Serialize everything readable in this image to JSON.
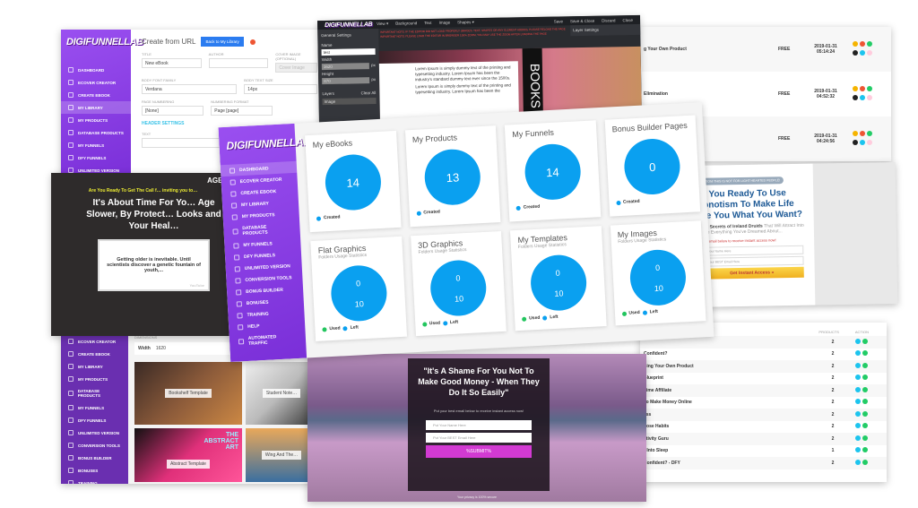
{
  "brand": {
    "logo": "DIGIFUNNELLAB",
    "primary": "#8a3fe6",
    "accent": "#0aa0f0",
    "used": "#22c55e"
  },
  "sidebar": {
    "items": [
      "DASHBOARD",
      "ECOVER CREATOR",
      "CREATE EBOOK",
      "MY LIBRARY",
      "MY PRODUCTS",
      "DATABASE PRODUCTS",
      "MY FUNNELS",
      "DFY FUNNELS",
      "UNLIMITED VERSION",
      "CONVERSION TOOLS",
      "BONUS BUILDER",
      "BONUSES",
      "TRAINING",
      "HELP",
      "AUTOMATED TRAFFIC"
    ]
  },
  "create_from_url": {
    "title": "Create from URL",
    "back_button": "Back to My Library",
    "fields": [
      {
        "label": "TITLE",
        "value": "New eBook"
      },
      {
        "label": "AUTHOR",
        "value": ""
      },
      {
        "label": "COVER IMAGE (OPTIONAL)",
        "placeholder": "Cover Image"
      }
    ],
    "font_label": "BODY FONT FAMILY",
    "font_value": "Verdana",
    "size_label": "BODY TEXT SIZE",
    "size_value": "14px",
    "numbering_label": "PAGE NUMBERING",
    "numbering_value": "[None]",
    "format_label": "NUMBERING FORMAT",
    "format_value": "Page [page]",
    "header_settings": "HEADER SETTINGS",
    "text_label": "TEXT"
  },
  "editor": {
    "menu": [
      "View ▾",
      "Background",
      "Text",
      "Image",
      "Shapes ▾"
    ],
    "actions": [
      "Save",
      "Save & Close",
      "Discard",
      "Close"
    ],
    "general_settings": "General Settings",
    "layer_settings": "Layer Settings",
    "name_label": "Name",
    "name_value": "test",
    "width_label": "Width",
    "width_value": "1620",
    "height_label": "Height",
    "height_value": "870",
    "unit": "px",
    "layers": "Layers",
    "clear_all": "Clear All",
    "layer_item": "Image",
    "notice1": "IMPORTANT NOTE: IF THE EDITOR DID NOT LOAD PROPERLY (IMAGES, TEXT, SHAPES OR ANY ELEMENT ADDED), PLEASE RELOAD THE PAGE",
    "notice2": "IMPORTANT NOTE: PLEASE LOAD THE EDITOR IN BROWSER 100% ZOOM, YOU MAY USE THE ZOOM AFTER LOADING THE PAGE",
    "canvas_text": "Lorem Ipsum is simply dummy text of the printing and typesetting industry. Lorem Ipsum has been the industry's standard dummy text ever since the 1500s.",
    "canvas_text2": "Lorem Ipsum is simply dummy text of the printing and typesetting industry. Lorem Ipsum has been the",
    "books": "BOOKS"
  },
  "library_top": {
    "rows": [
      {
        "title": "g Your Own Product",
        "price": "FREE",
        "date": "2019-01-31",
        "time": "05:14:24"
      },
      {
        "title": "Elimination",
        "price": "FREE",
        "date": "2019-01-31",
        "time": "04:52:32"
      },
      {
        "title": "",
        "price": "FREE",
        "date": "2019-01-31",
        "time": "04:24:56"
      }
    ]
  },
  "age_page": {
    "brand": "AGE S",
    "headline_small": "Are You Ready To Get The Call f… inviting you to…",
    "headline": "It's About Time For Yo… Age Slower, By Protect… Looks and Your Heal…",
    "video_text": "Getting older is inevitable. Until scientists discover a genetic fountain of youth,...",
    "video_brand": "YouTube"
  },
  "hypno_page": {
    "badge": "ATTENTION! THIS IS NOT FOR LIGHT HEARTED PEOPLE!",
    "headline": "Are You Ready To Use Hypnotism To Make Life Give You What You Want?",
    "sub_strong": "Ancient Secrets of Ireland Druids",
    "sub": " That Will Attract Into Your Life Everything You've Dreamed About...",
    "cta_text": "Your best email below to receive instant access now!",
    "name_placeholder": "Put Your Name Here",
    "email_placeholder": "Put Your BEST Email Here",
    "button": "Get Instant Access »"
  },
  "dashboard": {
    "cards": [
      {
        "title": "My eBooks",
        "sub": "",
        "value": "14",
        "legend": [
          "Created"
        ]
      },
      {
        "title": "My Products",
        "sub": "",
        "value": "13",
        "legend": [
          "Created"
        ]
      },
      {
        "title": "My Funnels",
        "sub": "",
        "value": "14",
        "legend": [
          "Created"
        ]
      },
      {
        "title": "Bonus Builder Pages",
        "sub": "",
        "value": "0",
        "legend": [
          "Created"
        ]
      },
      {
        "title": "Flat Graphics",
        "sub": "Folders Usage Statistics",
        "used": "0",
        "left": "10",
        "legend": [
          "Used",
          "Left"
        ]
      },
      {
        "title": "3D Graphics",
        "sub": "Folders Usage Statistics",
        "used": "0",
        "left": "10",
        "legend": [
          "Used",
          "Left"
        ]
      },
      {
        "title": "My Templates",
        "sub": "Folders Usage Statistics",
        "used": "0",
        "left": "10",
        "legend": [
          "Used",
          "Left"
        ]
      },
      {
        "title": "My Images",
        "sub": "Folders Usage Statistics",
        "used": "0",
        "left": "10",
        "legend": [
          "Used",
          "Left"
        ]
      }
    ]
  },
  "templates": {
    "dimensions": "Dimensions",
    "width_label": "Width",
    "width_value": "1620",
    "items": [
      "Bookshelf Template",
      "Student Note…",
      "Abstract Template",
      "Wing And The…"
    ],
    "abstract_art": "THE ABSTRACT ART"
  },
  "shame_page": {
    "headline": "\"It's A Shame For You Not To Make Good Money - When They Do It So Easily\"",
    "cta": "Put your best email below to receive instant access now!",
    "name_placeholder": "Put Your Name Here",
    "email_placeholder": "Put Your BEST Email Here",
    "button": "%SUBMIT%",
    "privacy": "Your privacy is 100% secure"
  },
  "products_table": {
    "headers": [
      "PRODUCTS",
      "ACTION"
    ],
    "rows": [
      {
        "title": "",
        "count": "2"
      },
      {
        "title": "Confident?",
        "count": "2"
      },
      {
        "title": "Sing Your Own Product",
        "count": "2"
      },
      {
        "title": "Blueprint",
        "count": "2"
      },
      {
        "title": "Time Affiliate",
        "count": "2"
      },
      {
        "title": "To Make Money Online",
        "count": "2"
      },
      {
        "title": "ess",
        "count": "2"
      },
      {
        "title": "Lose Habits",
        "count": "2"
      },
      {
        "title": "ctivity Guru",
        "count": "2"
      },
      {
        "title": "r Into Sleep",
        "count": "1"
      },
      {
        "title": "Confident? - DFY",
        "count": "2"
      }
    ]
  }
}
